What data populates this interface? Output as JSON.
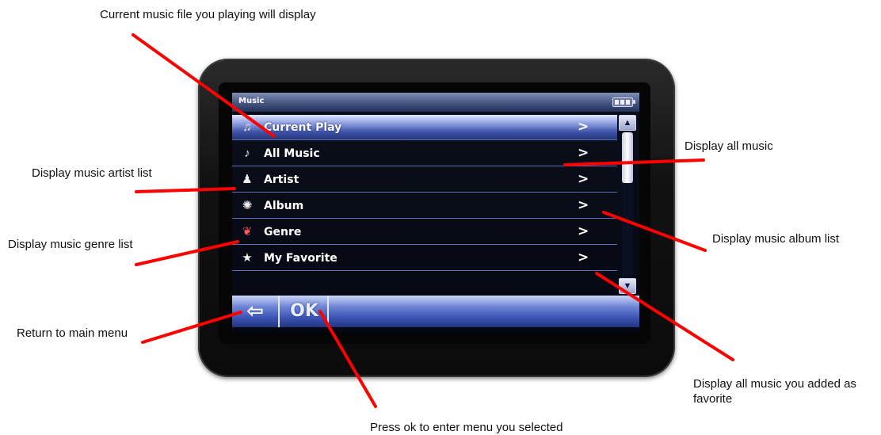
{
  "annotations": {
    "current_play_note": "Current  music file you playing will display",
    "all_music_note": "Display all music",
    "artist_note": "Display music artist list",
    "genre_note": "Display music genre list",
    "album_note": "Display music album list",
    "return_note": "Return to main menu",
    "favorite_note": "Display all music you added as favorite",
    "ok_note": "Press ok to enter menu you selected"
  },
  "screen": {
    "title": "Music",
    "menu_items": [
      {
        "label": "Current Play",
        "icon": "disc-note-icon",
        "glyph": "♫",
        "selected": true
      },
      {
        "label": "All Music",
        "icon": "music-folder-icon",
        "glyph": "♪"
      },
      {
        "label": "Artist",
        "icon": "singer-icon",
        "glyph": "♟"
      },
      {
        "label": "Album",
        "icon": "album-icon",
        "glyph": "✺"
      },
      {
        "label": "Genre",
        "icon": "genre-icon",
        "glyph": "❦"
      },
      {
        "label": "My Favorite",
        "icon": "star-icon",
        "glyph": "★"
      }
    ],
    "chevron": ">",
    "back_glyph": "⇦",
    "ok_label": "OK"
  },
  "colors": {
    "pointer_line": "#ff0000",
    "row_divider": "#5c6fb8",
    "bar_blue": "#3b54b4"
  }
}
